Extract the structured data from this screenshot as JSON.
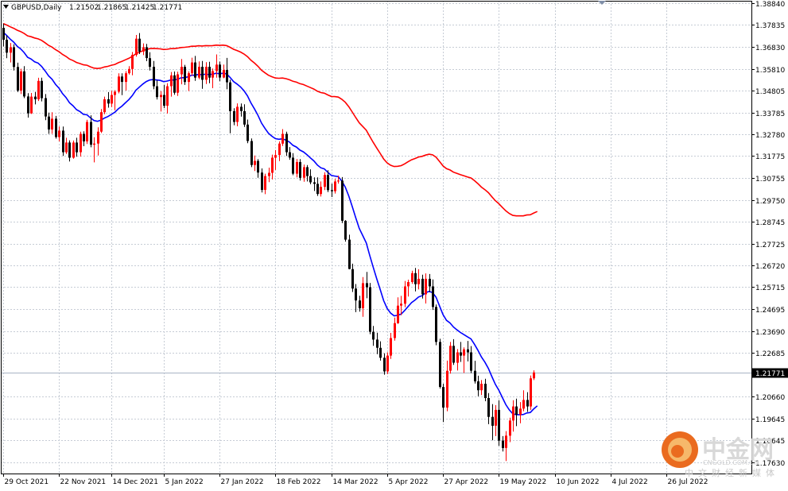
{
  "chart_data": {
    "type": "candlestick",
    "title": "GBPUSD,Daily",
    "ohlc_header": [
      "1.21502",
      "1.21865",
      "1.21425",
      "1.21771"
    ],
    "current_price_label": "1.21771",
    "current_price": 1.21771,
    "ylim": [
      1.171,
      1.3895
    ],
    "y_ticks": [
      {
        "label": "1.38840",
        "value": 1.3884
      },
      {
        "label": "1.37835",
        "value": 1.37835
      },
      {
        "label": "1.36830",
        "value": 1.3683
      },
      {
        "label": "1.35810",
        "value": 1.3581
      },
      {
        "label": "1.34805",
        "value": 1.34805
      },
      {
        "label": "1.33785",
        "value": 1.33785
      },
      {
        "label": "1.32780",
        "value": 1.3278
      },
      {
        "label": "1.31775",
        "value": 1.31775
      },
      {
        "label": "1.30755",
        "value": 1.30755
      },
      {
        "label": "1.29750",
        "value": 1.2975
      },
      {
        "label": "1.28745",
        "value": 1.28745
      },
      {
        "label": "1.27725",
        "value": 1.27725
      },
      {
        "label": "1.26720",
        "value": 1.2672
      },
      {
        "label": "1.25715",
        "value": 1.25715
      },
      {
        "label": "1.24695",
        "value": 1.24695
      },
      {
        "label": "1.23690",
        "value": 1.2369
      },
      {
        "label": "1.22685",
        "value": 1.22685
      },
      {
        "label": "1.20660",
        "value": 1.2066
      },
      {
        "label": "1.19645",
        "value": 1.19645
      },
      {
        "label": "1.18645",
        "value": 1.18645
      },
      {
        "label": "1.17630",
        "value": 1.1763
      }
    ],
    "x_ticks": [
      {
        "label": "29 Oct 2021",
        "bar": 0
      },
      {
        "label": "22 Nov 2021",
        "bar": 16
      },
      {
        "label": "14 Dec 2021",
        "bar": 31
      },
      {
        "label": "5 Jan 2022",
        "bar": 46
      },
      {
        "label": "27 Jan 2022",
        "bar": 62
      },
      {
        "label": "18 Feb 2022",
        "bar": 78
      },
      {
        "label": "14 Mar 2022",
        "bar": 94
      },
      {
        "label": "5 Apr 2022",
        "bar": 110
      },
      {
        "label": "27 Apr 2022",
        "bar": 126
      },
      {
        "label": "19 May 2022",
        "bar": 142
      },
      {
        "label": "10 Jun 2022",
        "bar": 158
      },
      {
        "label": "4 Jul 2022",
        "bar": 174
      },
      {
        "label": "26 Jul 2022",
        "bar": 190
      }
    ],
    "candles_ohlc": [
      [
        1.377,
        1.3789,
        1.3684,
        1.3715
      ],
      [
        1.3715,
        1.3735,
        1.363,
        1.3655
      ],
      [
        1.3655,
        1.37,
        1.361,
        1.368
      ],
      [
        1.368,
        1.3694,
        1.3573,
        1.3589
      ],
      [
        1.3589,
        1.3609,
        1.3473,
        1.348
      ],
      [
        1.348,
        1.3581,
        1.3464,
        1.3569
      ],
      [
        1.3569,
        1.3593,
        1.3445,
        1.3453
      ],
      [
        1.3453,
        1.3468,
        1.3355,
        1.3375
      ],
      [
        1.3375,
        1.3469,
        1.3372,
        1.3452
      ],
      [
        1.3452,
        1.3474,
        1.3416,
        1.344
      ],
      [
        1.344,
        1.3539,
        1.3432,
        1.3525
      ],
      [
        1.3525,
        1.354,
        1.343,
        1.3445
      ],
      [
        1.3445,
        1.3464,
        1.3343,
        1.336
      ],
      [
        1.336,
        1.3378,
        1.328,
        1.33
      ],
      [
        1.33,
        1.338,
        1.328,
        1.335
      ],
      [
        1.335,
        1.3363,
        1.3258,
        1.3265
      ],
      [
        1.3265,
        1.3314,
        1.3245,
        1.3295
      ],
      [
        1.3295,
        1.3314,
        1.3178,
        1.3195
      ],
      [
        1.3195,
        1.3262,
        1.3187,
        1.324
      ],
      [
        1.324,
        1.325,
        1.3152,
        1.317
      ],
      [
        1.317,
        1.3249,
        1.3165,
        1.324
      ],
      [
        1.324,
        1.3262,
        1.3174,
        1.3195
      ],
      [
        1.3195,
        1.329,
        1.3175,
        1.328
      ],
      [
        1.328,
        1.3292,
        1.3223,
        1.3245
      ],
      [
        1.3245,
        1.3345,
        1.3233,
        1.3335
      ],
      [
        1.3335,
        1.3366,
        1.3218,
        1.323
      ],
      [
        1.323,
        1.3264,
        1.3148,
        1.3235
      ],
      [
        1.3235,
        1.331,
        1.318,
        1.329
      ],
      [
        1.329,
        1.3395,
        1.3284,
        1.338
      ],
      [
        1.338,
        1.3452,
        1.3371,
        1.344
      ],
      [
        1.344,
        1.3473,
        1.3401,
        1.342
      ],
      [
        1.342,
        1.3479,
        1.3404,
        1.346
      ],
      [
        1.346,
        1.3482,
        1.3389,
        1.3475
      ],
      [
        1.3475,
        1.356,
        1.3467,
        1.3545
      ],
      [
        1.3545,
        1.356,
        1.3459,
        1.352
      ],
      [
        1.352,
        1.357,
        1.348,
        1.356
      ],
      [
        1.356,
        1.3593,
        1.3554,
        1.358
      ],
      [
        1.358,
        1.3658,
        1.3551,
        1.3645
      ],
      [
        1.3645,
        1.3737,
        1.3637,
        1.372
      ],
      [
        1.372,
        1.3746,
        1.3649,
        1.366
      ],
      [
        1.366,
        1.3698,
        1.3644,
        1.368
      ],
      [
        1.368,
        1.3696,
        1.3616,
        1.363
      ],
      [
        1.363,
        1.3657,
        1.3573,
        1.359
      ],
      [
        1.359,
        1.3617,
        1.3486,
        1.35
      ],
      [
        1.35,
        1.3528,
        1.3439,
        1.345
      ],
      [
        1.345,
        1.3477,
        1.3383,
        1.346
      ],
      [
        1.346,
        1.3506,
        1.3399,
        1.341
      ],
      [
        1.341,
        1.3514,
        1.3374,
        1.35
      ],
      [
        1.35,
        1.3566,
        1.3452,
        1.355
      ],
      [
        1.355,
        1.3568,
        1.3461,
        1.347
      ],
      [
        1.347,
        1.3567,
        1.3455,
        1.3555
      ],
      [
        1.3555,
        1.3626,
        1.3509,
        1.359
      ],
      [
        1.359,
        1.3599,
        1.3506,
        1.352
      ],
      [
        1.352,
        1.3569,
        1.3478,
        1.356
      ],
      [
        1.356,
        1.3632,
        1.3548,
        1.361
      ],
      [
        1.361,
        1.364,
        1.3525,
        1.354
      ],
      [
        1.354,
        1.3615,
        1.3532,
        1.359
      ],
      [
        1.359,
        1.3617,
        1.3488,
        1.353
      ],
      [
        1.353,
        1.3611,
        1.351,
        1.359
      ],
      [
        1.359,
        1.3613,
        1.3514,
        1.354
      ],
      [
        1.354,
        1.3582,
        1.3491,
        1.357
      ],
      [
        1.357,
        1.3647,
        1.354,
        1.36
      ],
      [
        1.36,
        1.3614,
        1.3523,
        1.354
      ],
      [
        1.354,
        1.36,
        1.3537,
        1.3575
      ],
      [
        1.3575,
        1.3631,
        1.3486,
        1.3518
      ],
      [
        1.3518,
        1.353,
        1.3283,
        1.3385
      ],
      [
        1.3385,
        1.3398,
        1.332,
        1.3335
      ],
      [
        1.3335,
        1.3421,
        1.3315,
        1.3405
      ],
      [
        1.3405,
        1.342,
        1.336,
        1.3385
      ],
      [
        1.3385,
        1.3417,
        1.3312,
        1.3323
      ],
      [
        1.3323,
        1.3346,
        1.3237,
        1.3247
      ],
      [
        1.3247,
        1.3259,
        1.3126,
        1.3136
      ],
      [
        1.3136,
        1.318,
        1.3108,
        1.3155
      ],
      [
        1.3155,
        1.3163,
        1.3077,
        1.3101
      ],
      [
        1.3101,
        1.312,
        1.3009,
        1.3021
      ],
      [
        1.3021,
        1.3096,
        1.3001,
        1.3085
      ],
      [
        1.3085,
        1.3124,
        1.3057,
        1.31
      ],
      [
        1.31,
        1.3184,
        1.3069,
        1.317
      ],
      [
        1.317,
        1.3205,
        1.3113,
        1.3182
      ],
      [
        1.3182,
        1.3245,
        1.3154,
        1.3235
      ],
      [
        1.3235,
        1.3302,
        1.3224,
        1.328
      ],
      [
        1.328,
        1.329,
        1.3178,
        1.3195
      ],
      [
        1.3195,
        1.3219,
        1.316,
        1.317
      ],
      [
        1.317,
        1.3191,
        1.3089,
        1.3096
      ],
      [
        1.3096,
        1.3164,
        1.3079,
        1.315
      ],
      [
        1.315,
        1.3163,
        1.3064,
        1.3077
      ],
      [
        1.3077,
        1.3138,
        1.3059,
        1.3126
      ],
      [
        1.3126,
        1.3136,
        1.306,
        1.3085
      ],
      [
        1.3085,
        1.3116,
        1.3047,
        1.3056
      ],
      [
        1.3056,
        1.3079,
        1.3016,
        1.3049
      ],
      [
        1.3049,
        1.3079,
        1.2993,
        1.3002
      ],
      [
        1.3002,
        1.306,
        1.299,
        1.3035
      ],
      [
        1.3035,
        1.3102,
        1.302,
        1.309
      ],
      [
        1.309,
        1.3112,
        1.3011,
        1.302
      ],
      [
        1.302,
        1.305,
        1.2988,
        1.3015
      ],
      [
        1.3015,
        1.3072,
        1.3004,
        1.306
      ],
      [
        1.306,
        1.3087,
        1.305,
        1.3064
      ],
      [
        1.3064,
        1.308,
        1.2868,
        1.2878
      ],
      [
        1.2878,
        1.2881,
        1.2782,
        1.2791
      ],
      [
        1.2791,
        1.2814,
        1.2654,
        1.2655
      ],
      [
        1.2655,
        1.268,
        1.2549,
        1.2565
      ],
      [
        1.2565,
        1.2586,
        1.2456,
        1.251
      ],
      [
        1.251,
        1.2532,
        1.2458,
        1.2474
      ],
      [
        1.2474,
        1.2618,
        1.2434,
        1.259
      ],
      [
        1.259,
        1.2642,
        1.252,
        1.2571
      ],
      [
        1.2571,
        1.2591,
        1.2354,
        1.2365
      ],
      [
        1.2365,
        1.2392,
        1.23,
        1.2329
      ],
      [
        1.2329,
        1.2361,
        1.2262,
        1.2291
      ],
      [
        1.2291,
        1.2321,
        1.2232,
        1.2245
      ],
      [
        1.2245,
        1.2266,
        1.2167,
        1.2182
      ],
      [
        1.2182,
        1.227,
        1.217,
        1.2255
      ],
      [
        1.2255,
        1.236,
        1.224,
        1.2336
      ],
      [
        1.2336,
        1.2431,
        1.2324,
        1.2405
      ],
      [
        1.2405,
        1.2524,
        1.2402,
        1.2486
      ],
      [
        1.2486,
        1.2531,
        1.2442,
        1.2495
      ],
      [
        1.2495,
        1.26,
        1.2479,
        1.2575
      ],
      [
        1.2575,
        1.2606,
        1.2528,
        1.2595
      ],
      [
        1.2595,
        1.2647,
        1.2587,
        1.2636
      ],
      [
        1.2636,
        1.266,
        1.2552,
        1.2585
      ],
      [
        1.2585,
        1.2654,
        1.2561,
        1.261
      ],
      [
        1.261,
        1.2629,
        1.2519,
        1.2538
      ],
      [
        1.2538,
        1.2635,
        1.2496,
        1.261
      ],
      [
        1.261,
        1.2632,
        1.2548,
        1.2575
      ],
      [
        1.2575,
        1.2607,
        1.2466,
        1.248
      ],
      [
        1.248,
        1.2491,
        1.2303,
        1.2318
      ],
      [
        1.2318,
        1.2333,
        1.2103,
        1.211
      ],
      [
        1.211,
        1.2125,
        1.1948,
        1.2015
      ],
      [
        1.2015,
        1.2232,
        1.1998,
        1.2185
      ],
      [
        1.2185,
        1.2318,
        1.2172,
        1.23
      ],
      [
        1.23,
        1.2331,
        1.2212,
        1.2222
      ],
      [
        1.2222,
        1.2285,
        1.2186,
        1.227
      ],
      [
        1.227,
        1.2318,
        1.2226,
        1.2255
      ],
      [
        1.2255,
        1.2293,
        1.2175,
        1.2284
      ],
      [
        1.2284,
        1.2323,
        1.2228,
        1.227
      ],
      [
        1.227,
        1.2299,
        1.2174,
        1.2185
      ],
      [
        1.2185,
        1.2231,
        1.2126,
        1.2136
      ],
      [
        1.2136,
        1.2162,
        1.2067,
        1.2095
      ],
      [
        1.2095,
        1.2142,
        1.2073,
        1.2125
      ],
      [
        1.2125,
        1.2148,
        1.2044,
        1.2059
      ],
      [
        1.2059,
        1.2082,
        1.1938,
        1.1972
      ],
      [
        1.1972,
        1.2031,
        1.1864,
        1.1931
      ],
      [
        1.1931,
        1.2026,
        1.1883,
        1.2004
      ],
      [
        1.2004,
        1.2049,
        1.1838,
        1.1862
      ],
      [
        1.1862,
        1.1883,
        1.1812,
        1.1828
      ],
      [
        1.1828,
        1.1906,
        1.1768,
        1.1885
      ],
      [
        1.1885,
        1.1968,
        1.1855,
        1.1955
      ],
      [
        1.1955,
        1.2049,
        1.1904,
        1.202
      ],
      [
        1.202,
        1.2056,
        1.1929,
        1.1982
      ],
      [
        1.1982,
        1.204,
        1.1942,
        1.201
      ],
      [
        1.201,
        1.2095,
        1.1998,
        1.205
      ],
      [
        1.205,
        1.2086,
        1.1995,
        1.202
      ],
      [
        1.202,
        1.2163,
        1.2004,
        1.215
      ],
      [
        1.215,
        1.2187,
        1.2142,
        1.2177
      ]
    ],
    "ma_blue": [
      1.375,
      1.3735,
      1.3718,
      1.3704,
      1.3685,
      1.3673,
      1.3656,
      1.3634,
      1.3626,
      1.3613,
      1.3607,
      1.3592,
      1.3571,
      1.3548,
      1.3532,
      1.3509,
      1.3491,
      1.3466,
      1.3448,
      1.3424,
      1.341,
      1.3392,
      1.3383,
      1.337,
      1.3368,
      1.3354,
      1.3342,
      1.3338,
      1.3343,
      1.3353,
      1.336,
      1.337,
      1.338,
      1.3396,
      1.3408,
      1.3423,
      1.3438,
      1.3457,
      1.3481,
      1.3496,
      1.351,
      1.3522,
      1.3529,
      1.3531,
      1.3529,
      1.3527,
      1.3521,
      1.3524,
      1.3529,
      1.3529,
      1.3533,
      1.3539,
      1.354,
      1.3544,
      1.3551,
      1.3551,
      1.3555,
      1.3553,
      1.3556,
      1.3554,
      1.3556,
      1.356,
      1.3558,
      1.356,
      1.3557,
      1.3541,
      1.3522,
      1.351,
      1.3497,
      1.3479,
      1.3455,
      1.3422,
      1.3395,
      1.3365,
      1.333,
      1.3305,
      1.3283,
      1.3269,
      1.3258,
      1.3255,
      1.3257,
      1.3251,
      1.3242,
      1.3227,
      1.3219,
      1.3205,
      1.3197,
      1.3184,
      1.3169,
      1.3155,
      1.3136,
      1.3123,
      1.3118,
      1.3102,
      1.3088,
      1.3085,
      1.3082,
      1.3062,
      1.3034,
      1.2993,
      1.2944,
      1.2892,
      1.2843,
      1.281,
      1.2776,
      1.2719,
      1.2664,
      1.2611,
      1.2561,
      1.2509,
      1.2473,
      1.2451,
      1.2439,
      1.2441,
      1.2447,
      1.2463,
      1.2482,
      1.25,
      1.2512,
      1.2526,
      1.2532,
      1.2545,
      1.2552,
      1.2546,
      1.2525,
      1.2484,
      1.2445,
      1.2418,
      1.2406,
      1.2387,
      1.2374,
      1.2362,
      1.2352,
      1.2342,
      1.2332,
      1.2308,
      1.228,
      1.2249,
      1.2225,
      1.2196,
      1.2158,
      1.2122,
      1.2095,
      1.2061,
      1.2028,
      1.2004,
      1.1986,
      1.1982,
      1.1982,
      1.1983,
      1.199,
      1.1992,
      1.2009,
      1.2023
    ],
    "ma_red": [
      1.379,
      1.3783,
      1.3775,
      1.3768,
      1.3759,
      1.3753,
      1.3744,
      1.3733,
      1.3729,
      1.3723,
      1.3719,
      1.3712,
      1.3701,
      1.3689,
      1.3681,
      1.3669,
      1.366,
      1.3647,
      1.3638,
      1.3626,
      1.3619,
      1.361,
      1.3605,
      1.3599,
      1.3597,
      1.359,
      1.3584,
      1.3582,
      1.3584,
      1.3589,
      1.3592,
      1.3597,
      1.3601,
      1.3609,
      1.3615,
      1.3622,
      1.3629,
      1.3638,
      1.365,
      1.3657,
      1.3664,
      1.367,
      1.3674,
      1.3675,
      1.3674,
      1.3673,
      1.367,
      1.3671,
      1.3674,
      1.3674,
      1.3676,
      1.3679,
      1.368,
      1.3682,
      1.3685,
      1.3685,
      1.3687,
      1.3686,
      1.3688,
      1.3687,
      1.3688,
      1.369,
      1.3689,
      1.369,
      1.3688,
      1.368,
      1.3671,
      1.3665,
      1.3658,
      1.3649,
      1.3637,
      1.362,
      1.3607,
      1.3592,
      1.3574,
      1.3562,
      1.3551,
      1.3544,
      1.3538,
      1.3537,
      1.3538,
      1.3535,
      1.353,
      1.3523,
      1.3519,
      1.3512,
      1.3508,
      1.3501,
      1.3494,
      1.3487,
      1.3477,
      1.3471,
      1.3468,
      1.346,
      1.3453,
      1.3452,
      1.345,
      1.344,
      1.3426,
      1.3406,
      1.3381,
      1.3355,
      1.3331,
      1.3314,
      1.3297,
      1.3269,
      1.3241,
      1.3215,
      1.319,
      1.3164,
      1.3146,
      1.3135,
      1.3129,
      1.313,
      1.3133,
      1.3141,
      1.3151,
      1.316,
      1.3166,
      1.3173,
      1.3176,
      1.3182,
      1.3186,
      1.3183,
      1.3172,
      1.3152,
      1.3132,
      1.3119,
      1.3113,
      1.3103,
      1.3097,
      1.3091,
      1.3086,
      1.3081,
      1.3076,
      1.3064,
      1.305,
      1.3034,
      1.3022,
      1.3008,
      1.2989,
      1.2971,
      1.2957,
      1.294,
      1.2924,
      1.2912,
      1.2903,
      1.2901,
      1.2901,
      1.2901,
      1.2905,
      1.2906,
      1.2914,
      1.2921
    ]
  },
  "watermark": {
    "brand_cn": "中金网",
    "domain": "CNGOLD.COM.CN",
    "tagline": "中文财经新媒体"
  }
}
